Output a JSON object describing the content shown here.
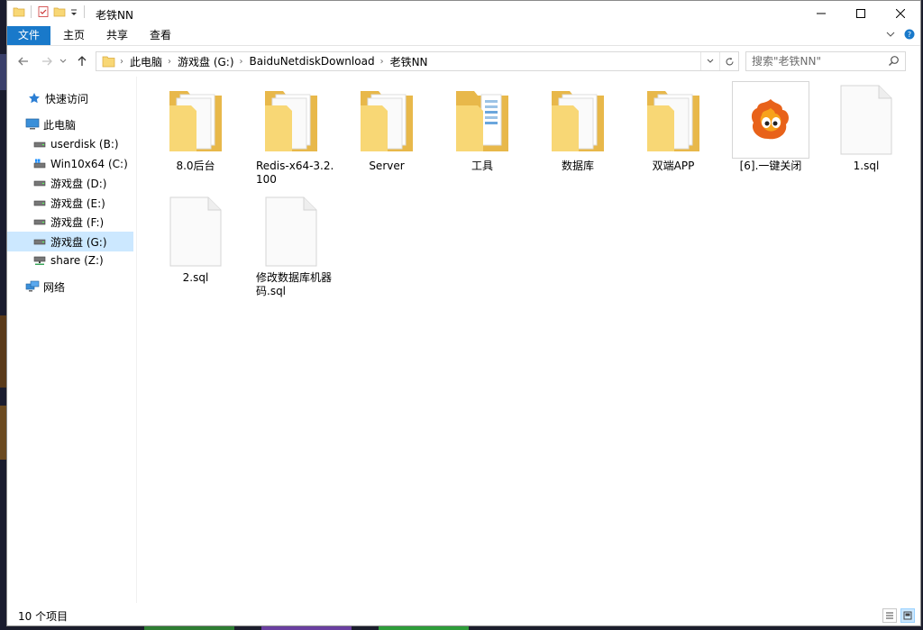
{
  "window": {
    "title": "老铁NN"
  },
  "ribbon": {
    "tabs": [
      "文件",
      "主页",
      "共享",
      "查看"
    ],
    "accent": "#1979ca"
  },
  "address": {
    "crumbs": [
      "此电脑",
      "游戏盘 (G:)",
      "BaiduNetdiskDownload",
      "老铁NN"
    ],
    "search_placeholder": "搜索\"老铁NN\""
  },
  "nav": {
    "items": [
      {
        "label": "快速访问",
        "icon": "star-icon"
      },
      {
        "label": "此电脑",
        "icon": "computer-icon"
      },
      {
        "label": "userdisk (B:)",
        "icon": "drive-icon"
      },
      {
        "label": "Win10x64 (C:)",
        "icon": "system-drive-icon"
      },
      {
        "label": "游戏盘 (D:)",
        "icon": "drive-icon"
      },
      {
        "label": "游戏盘 (E:)",
        "icon": "drive-icon"
      },
      {
        "label": "游戏盘 (F:)",
        "icon": "drive-icon"
      },
      {
        "label": "游戏盘 (G:)",
        "icon": "drive-icon",
        "selected": true
      },
      {
        "label": "share (Z:)",
        "icon": "network-drive-icon"
      },
      {
        "label": "网络",
        "icon": "network-icon"
      }
    ],
    "selected_color": "#cce8ff"
  },
  "files": [
    {
      "name": "8.0后台",
      "type": "folder"
    },
    {
      "name": "Redis-x64-3.2.100",
      "type": "folder"
    },
    {
      "name": "Server",
      "type": "folder"
    },
    {
      "name": "工具",
      "type": "folder"
    },
    {
      "name": "数据库",
      "type": "folder"
    },
    {
      "name": "双端APP",
      "type": "folder"
    },
    {
      "name": "[6].一键关闭",
      "type": "app"
    },
    {
      "name": "1.sql",
      "type": "file"
    },
    {
      "name": "2.sql",
      "type": "file"
    },
    {
      "name": "修改数据库机器码.sql",
      "type": "file"
    }
  ],
  "status": {
    "count": "10 个项目"
  },
  "colors": {
    "folder": "#f8d775",
    "folder_dark": "#e8b84a"
  }
}
